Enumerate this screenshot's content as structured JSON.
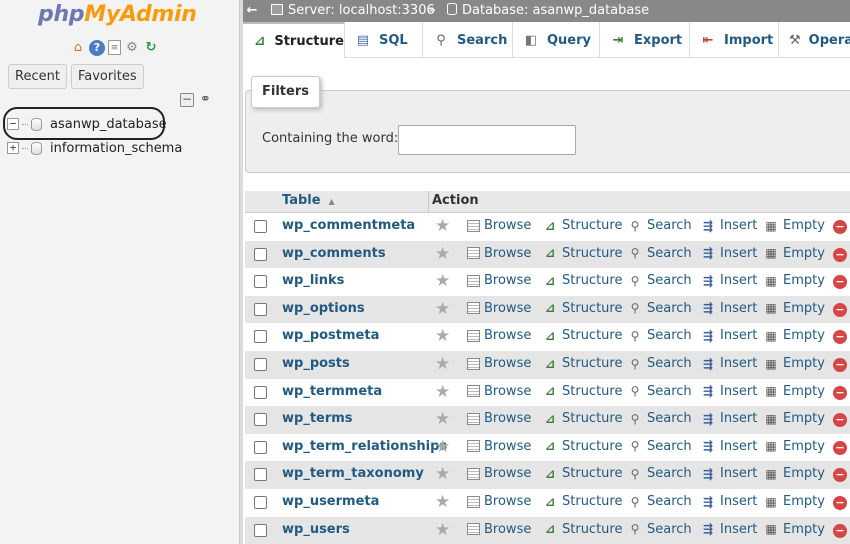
{
  "app": {
    "logo_part1": "php",
    "logo_part2": "MyAdmin"
  },
  "nav": {
    "recent_label": "Recent",
    "favorites_label": "Favorites",
    "databases": [
      {
        "name": "asanwp_database",
        "expander": "−"
      },
      {
        "name": "information_schema",
        "expander": "+"
      }
    ]
  },
  "breadcrumb": {
    "arrow": "←",
    "server": "Server: localhost:3306",
    "separator": "»",
    "database": "Database: asanwp_database"
  },
  "tabs": [
    {
      "label": "Structure",
      "icon": "structure-icon"
    },
    {
      "label": "SQL",
      "icon": "sql-icon"
    },
    {
      "label": "Search",
      "icon": "search-icon"
    },
    {
      "label": "Query",
      "icon": "query-icon"
    },
    {
      "label": "Export",
      "icon": "export-icon"
    },
    {
      "label": "Import",
      "icon": "import-icon"
    },
    {
      "label": "Opera",
      "icon": "wrench-icon"
    }
  ],
  "filters": {
    "legend": "Filters",
    "label": "Containing the word:",
    "value": ""
  },
  "table": {
    "col_table": "Table",
    "col_action": "Action",
    "sort_indicator": "▲",
    "actions": {
      "browse": "Browse",
      "structure": "Structure",
      "search": "Search",
      "insert": "Insert",
      "empty": "Empty"
    },
    "rows": [
      "wp_commentmeta",
      "wp_comments",
      "wp_links",
      "wp_options",
      "wp_postmeta",
      "wp_posts",
      "wp_termmeta",
      "wp_terms",
      "wp_term_relationships",
      "wp_term_taxonomy",
      "wp_usermeta",
      "wp_users"
    ]
  },
  "colors": {
    "link": "#235a81",
    "logo_blue": "#6c78af",
    "logo_orange": "#f89c0e",
    "drop": "#d64545"
  }
}
